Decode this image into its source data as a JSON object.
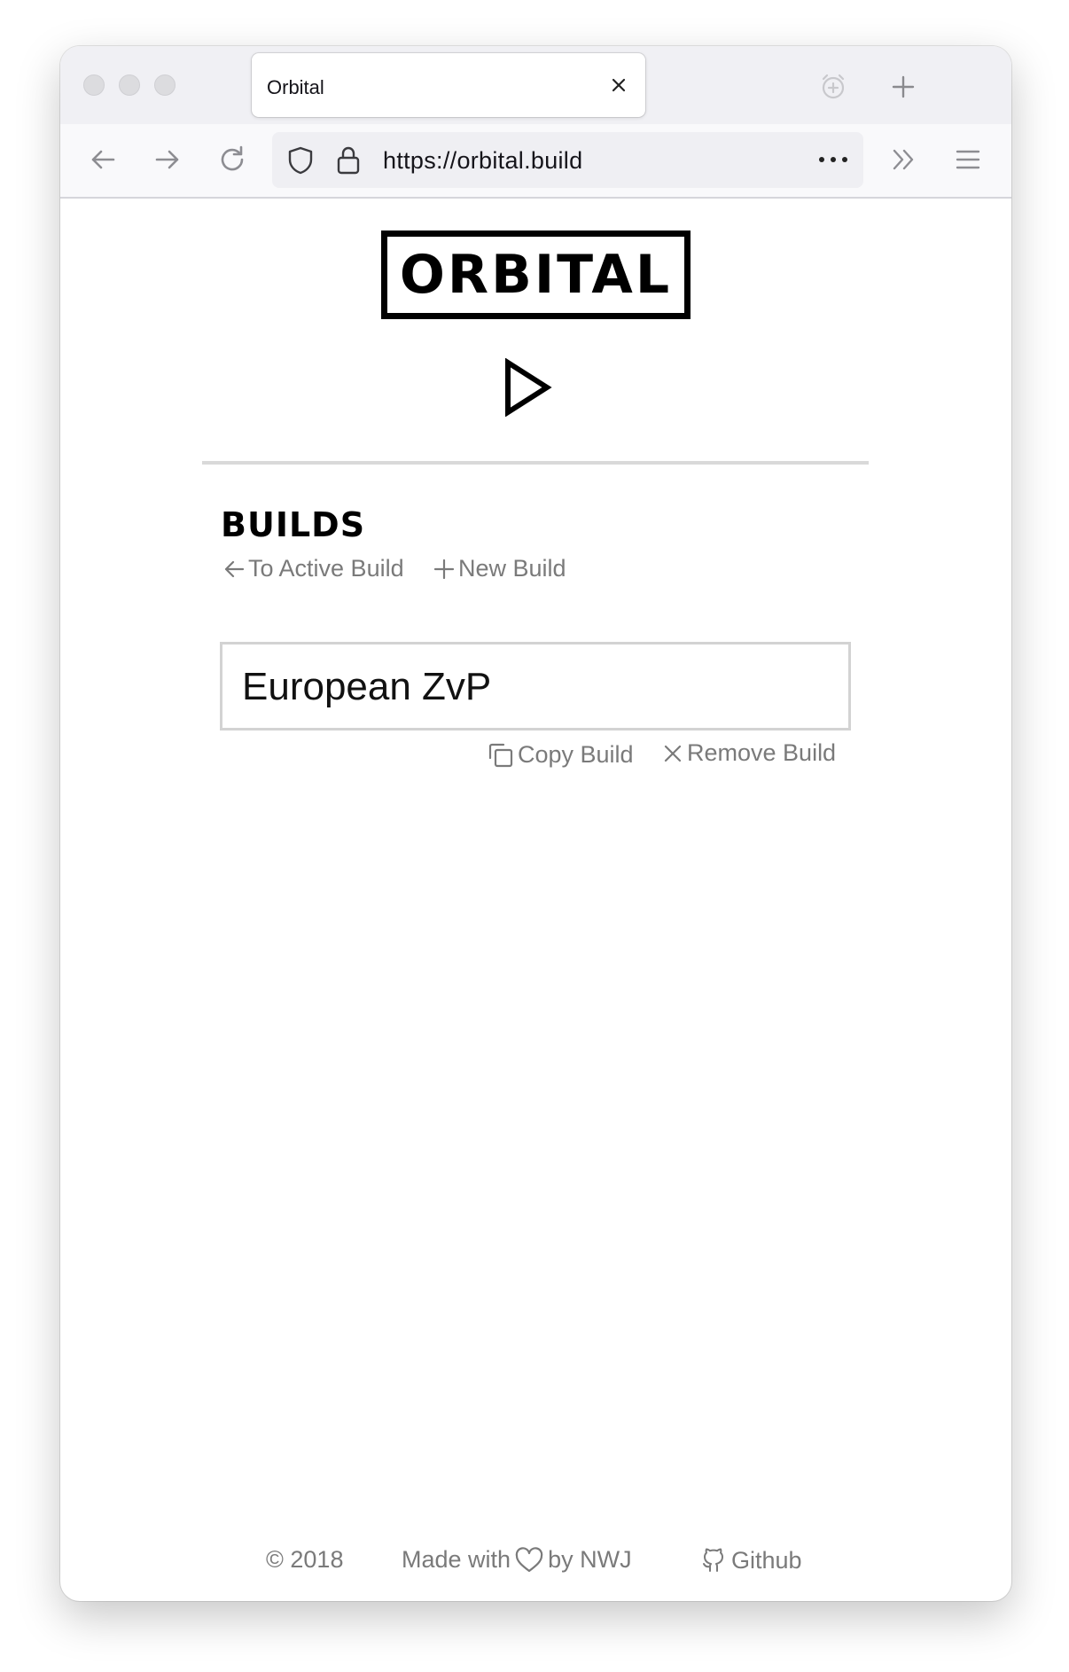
{
  "browser": {
    "tab_title": "Orbital",
    "url": "https://orbital.build"
  },
  "page": {
    "logo_text": "ORBITAL",
    "builds_heading": "BUILDS",
    "to_active_build": "To Active Build",
    "new_build": "New Build",
    "builds": [
      {
        "name": "European ZvP",
        "copy_label": "Copy Build",
        "remove_label": "Remove Build"
      }
    ]
  },
  "footer": {
    "copyright": "© 2018",
    "made_with": "Made with",
    "by": "by NWJ",
    "github": "Github"
  }
}
